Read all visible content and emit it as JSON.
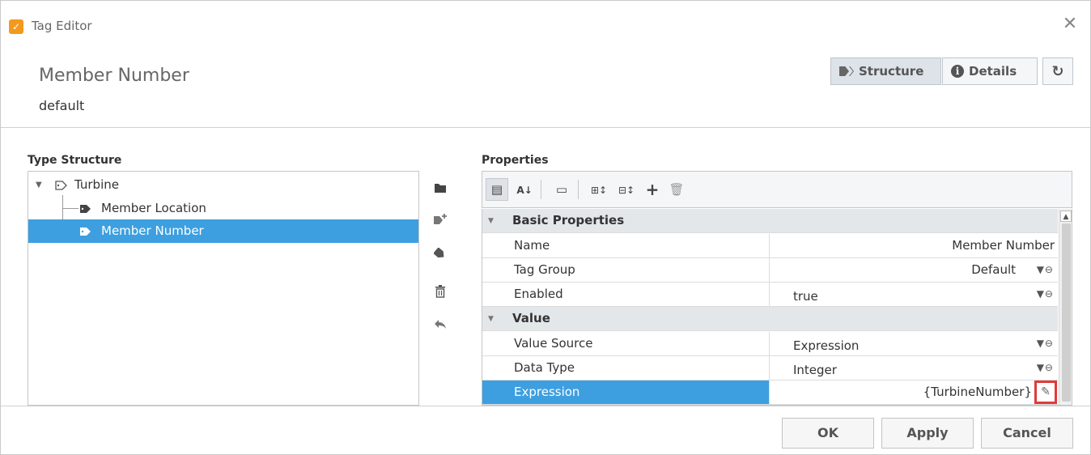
{
  "window": {
    "title": "Tag Editor",
    "app_icon": "ignition-tag-editor-icon",
    "close_glyph": "✕"
  },
  "header": {
    "tag_name": "Member Number",
    "provider": "default",
    "tabs": [
      {
        "label": "Structure",
        "icon": "tags-icon",
        "active": true
      },
      {
        "label": "Details",
        "icon": "info-icon",
        "active": false
      }
    ],
    "refresh_icon": "refresh-icon"
  },
  "type_structure": {
    "label": "Type Structure",
    "tree": {
      "root": {
        "label": "Turbine",
        "icon": "tag-outline-icon",
        "expanded": true
      },
      "children": [
        {
          "label": "Member Location",
          "icon": "tag-icon",
          "selected": false
        },
        {
          "label": "Member Number",
          "icon": "tag-icon",
          "selected": true
        }
      ]
    }
  },
  "side_actions": [
    "folder-icon",
    "add-tag-icon",
    "tags-icon",
    "delete-icon",
    "undo-icon"
  ],
  "properties": {
    "label": "Properties",
    "toolbar": [
      "categorized-icon",
      "sort-az-icon",
      "textbox-icon",
      "expand-all-icon",
      "collapse-all-icon",
      "add-icon",
      "delete-icon"
    ],
    "categories": [
      {
        "name": "Basic Properties",
        "rows": [
          {
            "name": "Name",
            "value": "Member Number",
            "align": "right",
            "bindable": false
          },
          {
            "name": "Tag Group",
            "value": "Default",
            "align": "right",
            "bindable": true
          },
          {
            "name": "Enabled",
            "value": "true",
            "align": "left",
            "bindable": true
          }
        ]
      },
      {
        "name": "Value",
        "rows": [
          {
            "name": "Value Source",
            "value": "Expression",
            "align": "left",
            "bindable": true
          },
          {
            "name": "Data Type",
            "value": "Integer",
            "align": "left",
            "bindable": true
          },
          {
            "name": "Expression",
            "value": "{TurbineNumber}",
            "align": "right",
            "selected": true,
            "editable": true
          }
        ]
      }
    ]
  },
  "footer": {
    "ok": "OK",
    "apply": "Apply",
    "cancel": "Cancel"
  },
  "colors": {
    "selection": "#3d9fe0",
    "highlight_border": "#e03a3a",
    "app_icon": "#f39a1e"
  }
}
